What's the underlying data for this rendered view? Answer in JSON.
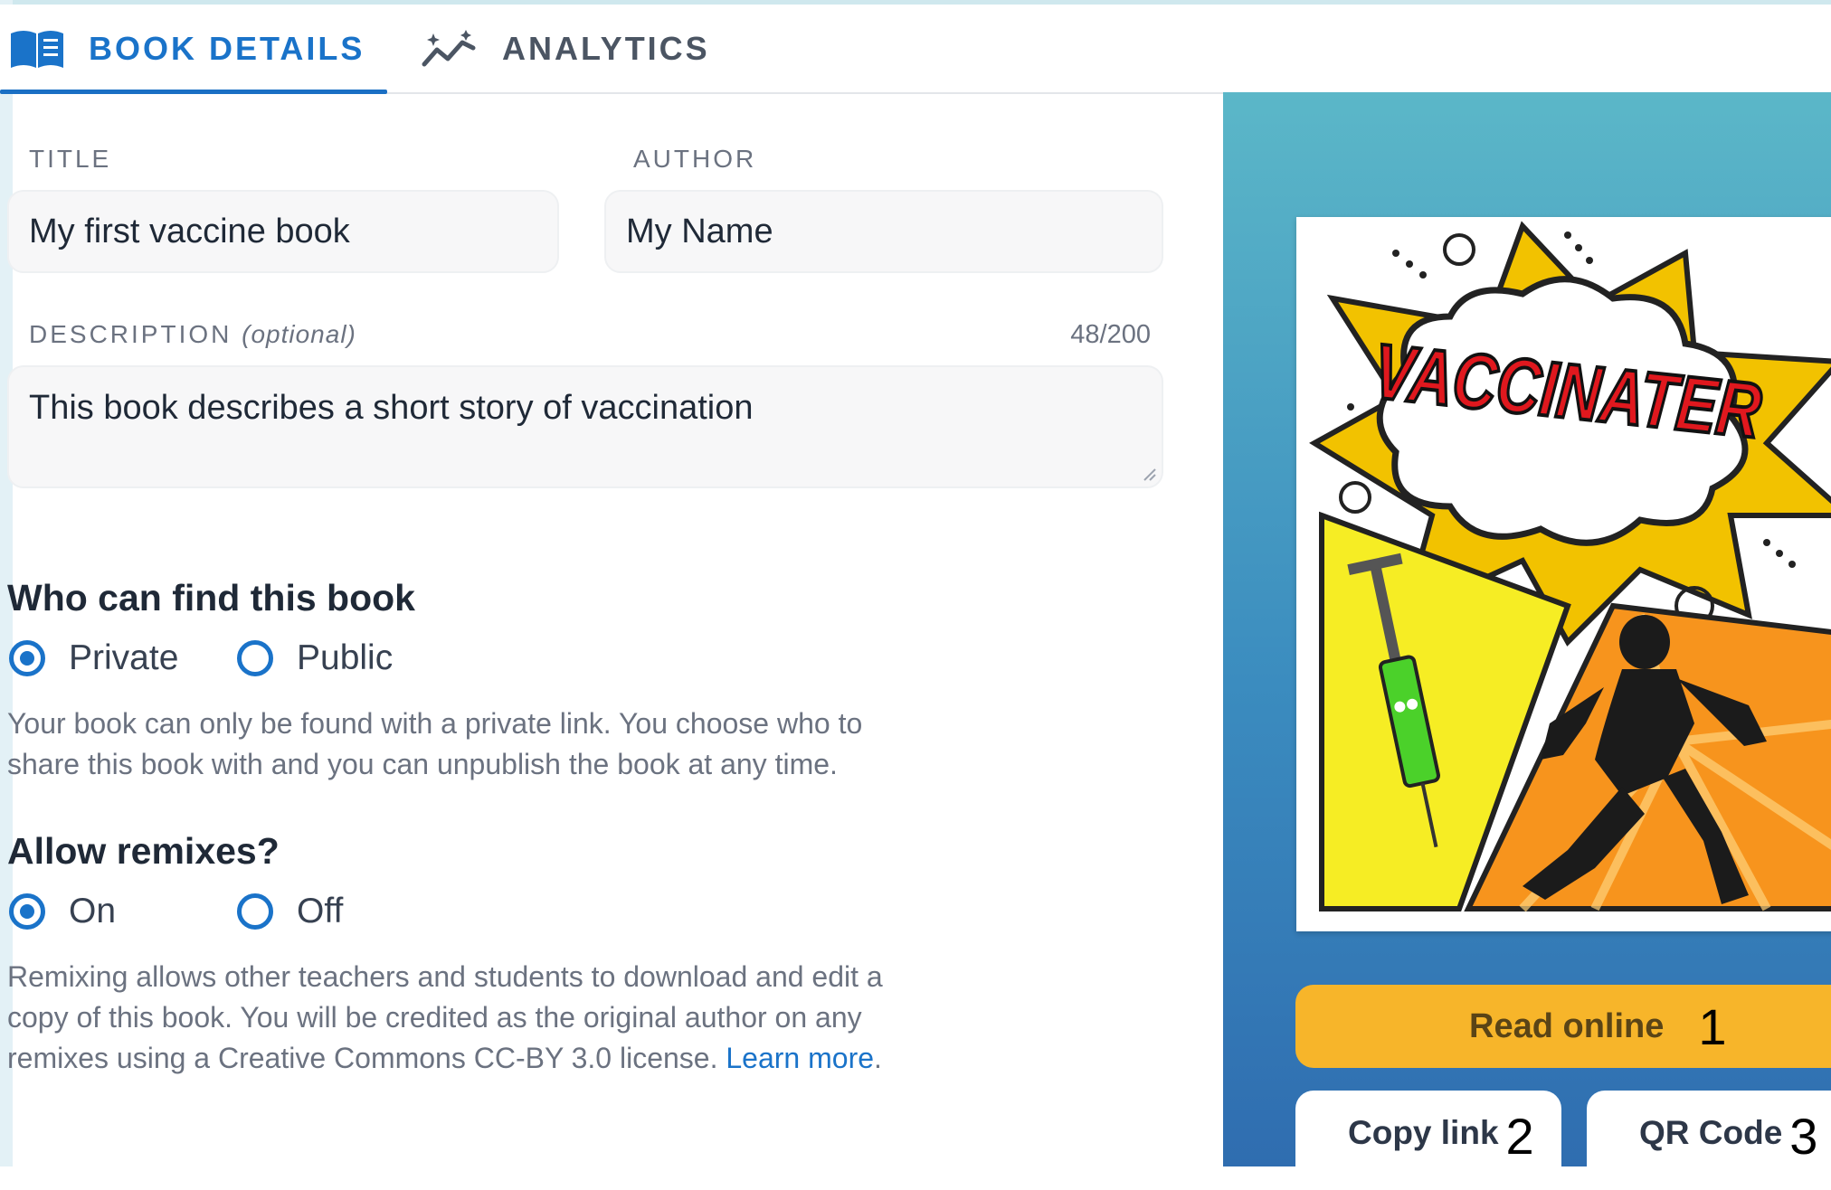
{
  "tabs": [
    {
      "label": "BOOK DETAILS",
      "icon": "book-icon",
      "active": true
    },
    {
      "label": "ANALYTICS",
      "icon": "sparkline-icon",
      "active": false
    }
  ],
  "form": {
    "title_label": "TITLE",
    "title_value": "My first vaccine book",
    "author_label": "AUTHOR",
    "author_value": "My Name",
    "description_label": "DESCRIPTION",
    "description_optional": "(optional)",
    "description_count": "48/200",
    "description_value": "This book describes a short story of vaccination"
  },
  "visibility": {
    "heading": "Who can find this book",
    "options": [
      "Private",
      "Public"
    ],
    "selected": "Private",
    "help_line1": "Your book can only be found with a private link. You choose who to",
    "help_line2": "share this book with and you can unpublish the book at any time."
  },
  "remix": {
    "heading": "Allow remixes?",
    "options": [
      "On",
      "Off"
    ],
    "selected": "On",
    "help_line1": "Remixing allows other teachers and students to download and edit a",
    "help_line2": "copy of this book. You will be credited as the original author on any",
    "help_line3": "remixes using a Creative Commons CC-BY 3.0 license.",
    "learn_more": "Learn more",
    "period": "."
  },
  "cover": {
    "title_text": "VACCINATER"
  },
  "actions": {
    "read_online": "Read online",
    "read_online_num": "1",
    "copy_link": "Copy link",
    "copy_link_num": "2",
    "qr_code": "QR Code",
    "qr_code_num": "3"
  },
  "colors": {
    "accent": "#1a73c9",
    "read_button": "#f7b52a",
    "panel_top": "#5bb7c8",
    "panel_bottom": "#2f6db0"
  }
}
